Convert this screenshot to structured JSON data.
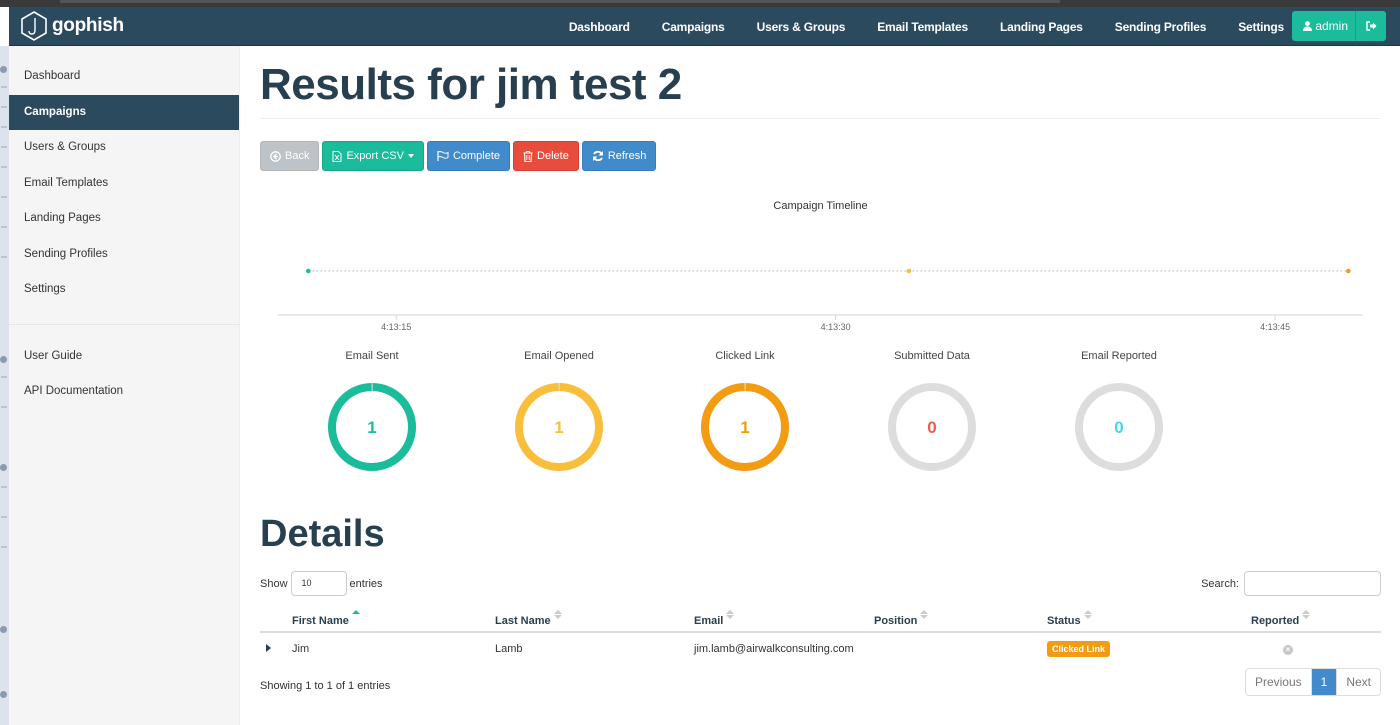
{
  "brand": {
    "name": "gophish",
    "logo_icon": "hook-hexagon-icon"
  },
  "navbar": {
    "links": [
      "Dashboard",
      "Campaigns",
      "Users & Groups",
      "Email Templates",
      "Landing Pages",
      "Sending Profiles",
      "Settings"
    ],
    "user_label": "admin",
    "user_icon": "user-icon",
    "logout_icon": "sign-out-icon",
    "accent_color": "#1abc9c",
    "background_color": "#2c4a5e"
  },
  "sidebar": {
    "items": [
      {
        "label": "Dashboard",
        "active": false
      },
      {
        "label": "Campaigns",
        "active": true
      },
      {
        "label": "Users & Groups",
        "active": false
      },
      {
        "label": "Email Templates",
        "active": false
      },
      {
        "label": "Landing Pages",
        "active": false
      },
      {
        "label": "Sending Profiles",
        "active": false
      },
      {
        "label": "Settings",
        "active": false
      }
    ],
    "secondary_items": [
      {
        "label": "User Guide"
      },
      {
        "label": "API Documentation"
      }
    ]
  },
  "main": {
    "title": "Results for jim test 2",
    "buttons": {
      "back": "Back",
      "export": "Export CSV",
      "complete": "Complete",
      "delete": "Delete",
      "refresh": "Refresh"
    },
    "timeline": {
      "title": "Campaign Timeline",
      "ticks": [
        "4:13:15",
        "4:13:30",
        "4:13:45"
      ],
      "events": [
        {
          "time_seconds": 12,
          "color": "#1abc9c"
        },
        {
          "time_seconds": 32.5,
          "color": "#f9bf3b"
        },
        {
          "time_seconds": 47.5,
          "color": "#f39c12"
        }
      ],
      "range_seconds": [
        11,
        48
      ]
    },
    "stats": [
      {
        "label": "Email Sent",
        "value": "1",
        "fraction": 1,
        "color": "#1abc9c"
      },
      {
        "label": "Email Opened",
        "value": "1",
        "fraction": 1,
        "color": "#f9bf3b"
      },
      {
        "label": "Clicked Link",
        "value": "1",
        "fraction": 1,
        "color": "#f39c12"
      },
      {
        "label": "Submitted Data",
        "value": "0",
        "fraction": 0,
        "color": "#f05b4f"
      },
      {
        "label": "Email Reported",
        "value": "0",
        "fraction": 0,
        "color": "#45d6ef"
      }
    ],
    "details": {
      "title": "Details",
      "show_label": "Show",
      "entries_value": "10",
      "entries_label": "entries",
      "search_label": "Search:",
      "search_value": "",
      "columns": [
        "First Name",
        "Last Name",
        "Email",
        "Position",
        "Status",
        "Reported"
      ],
      "rows": [
        {
          "first": "Jim",
          "last": "Lamb",
          "email": "jim.lamb@airwalkconsulting.com",
          "position": "",
          "status": "Clicked Link",
          "reported": "times-circle-icon"
        }
      ],
      "info": "Showing 1 to 1 of 1 entries",
      "pagination": {
        "previous": "Previous",
        "current": "1",
        "next": "Next"
      }
    }
  }
}
